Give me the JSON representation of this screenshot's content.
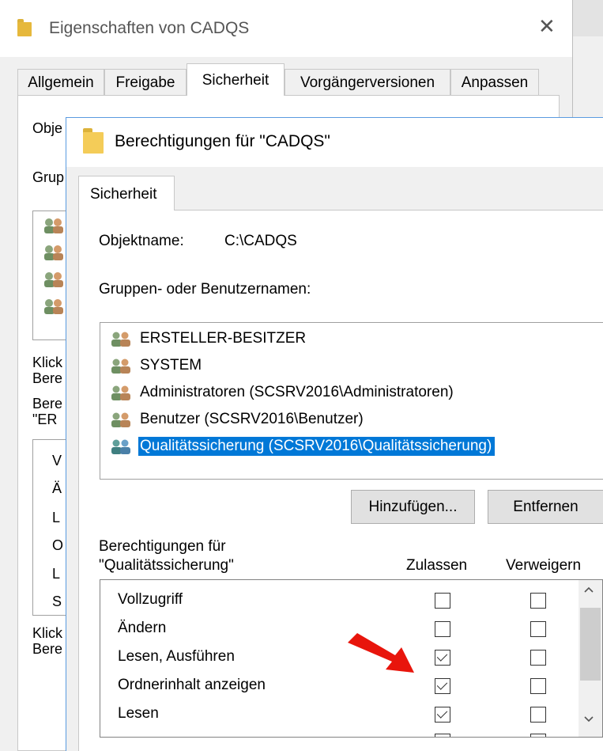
{
  "back_dialog": {
    "title": "Eigenschaften von CADQS",
    "close_glyph": "✕",
    "tabs": [
      "Allgemein",
      "Freigabe",
      "Sicherheit",
      "Vorgängerversionen",
      "Anpassen"
    ],
    "cut_labels": [
      "Obje",
      "Grup",
      "Klick",
      "Bere",
      "Bere",
      "\"ER",
      "Klick",
      "Bere"
    ],
    "cut_perm_letters": [
      "V",
      "Ä",
      "L",
      "O",
      "L",
      "S"
    ]
  },
  "dialog": {
    "title": "Berechtigungen für \"CADQS\"",
    "tab": "Sicherheit",
    "object_label": "Objektname:",
    "object_value": "C:\\CADQS",
    "groups_label": "Gruppen- oder Benutzernamen:",
    "users": [
      {
        "label": "ERSTELLER-BESITZER",
        "selected": false
      },
      {
        "label": "SYSTEM",
        "selected": false
      },
      {
        "label": "Administratoren (SCSRV2016\\Administratoren)",
        "selected": false
      },
      {
        "label": "Benutzer (SCSRV2016\\Benutzer)",
        "selected": false
      },
      {
        "label": "Qualitätssicherung (SCSRV2016\\Qualitätssicherung)",
        "selected": true
      }
    ],
    "add_button": "Hinzufügen...",
    "remove_button": "Entfernen",
    "perm_header_line1": "Berechtigungen für",
    "perm_header_line2": "\"Qualitätssicherung\"",
    "col_allow": "Zulassen",
    "col_deny": "Verweigern",
    "permissions": [
      {
        "name": "Vollzugriff",
        "allow": false,
        "deny": false
      },
      {
        "name": "Ändern",
        "allow": false,
        "deny": false
      },
      {
        "name": "Lesen, Ausführen",
        "allow": true,
        "deny": false
      },
      {
        "name": "Ordnerinhalt anzeigen",
        "allow": true,
        "deny": false
      },
      {
        "name": "Lesen",
        "allow": true,
        "deny": false
      }
    ]
  },
  "colors": {
    "selection": "#0078d7",
    "annotation_arrow": "#e8150c",
    "folder": "#f4cc58"
  },
  "icons": {
    "folder": "folder-icon",
    "users": "users-group-icon",
    "arrow": "red-arrow-annotation",
    "scroll_up": "chevron-up-icon",
    "scroll_down": "chevron-down-icon"
  }
}
